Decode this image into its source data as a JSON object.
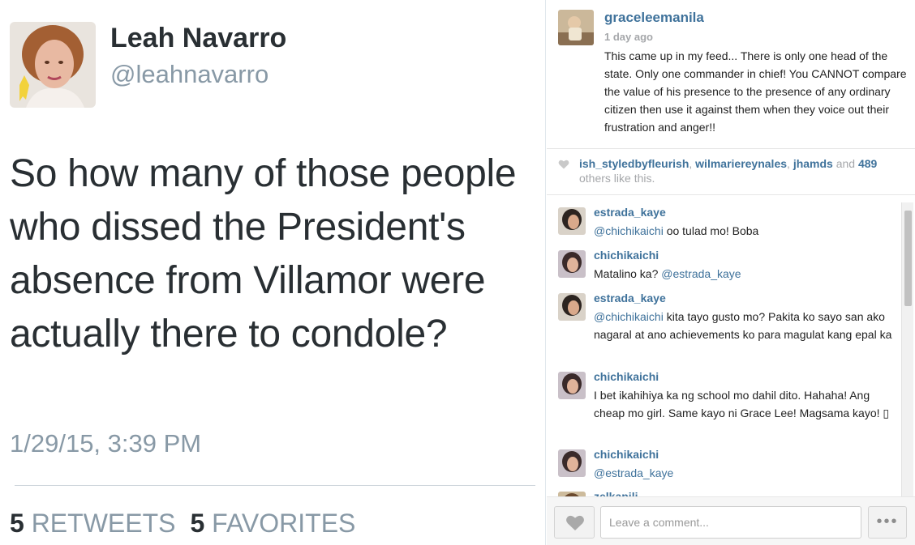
{
  "tweet": {
    "name": "Leah Navarro",
    "handle": "@leahnavarro",
    "text": "So how many of those people who dissed the President's absence from Villamor were actually there to condole?",
    "timestamp": "1/29/15, 3:39 PM",
    "retweets_count": "5",
    "retweets_label": "RETWEETS",
    "favorites_count": "5",
    "favorites_label": "FAVORITES"
  },
  "instagram": {
    "post": {
      "username": "graceleemanila",
      "time_ago": "1 day ago",
      "caption": "This came up in my feed... There is only one head of the state. Only one commander in chief! You CANNOT compare the value of his presence to the presence of any ordinary citizen then use it against them when they voice out their frustration and anger!!"
    },
    "likes": {
      "users": [
        "ish_styledbyfleurish",
        "wilmariereynales",
        "jhamds"
      ],
      "sep1": ", ",
      "sep2": ", ",
      "and_word": " and ",
      "count": "489",
      "suffix": " others like this."
    },
    "comments": [
      {
        "user": "estrada_kaye",
        "mention": "@chichikaichi",
        "text": " oo tulad mo! Boba"
      },
      {
        "user": "chichikaichi",
        "text": "Matalino ka? ",
        "mention_after": "@estrada_kaye"
      },
      {
        "user": "estrada_kaye",
        "mention": "@chichikaichi",
        "text": " kita tayo gusto mo? Pakita ko sayo san ako nagaral at ano achievements ko para magulat kang epal ka"
      },
      {
        "user": "chichikaichi",
        "text": "I bet ikahihiya ka ng school mo dahil dito. Hahaha! Ang cheap mo girl. Same kayo ni Grace Lee! Magsama kayo! ▯"
      },
      {
        "user": "chichikaichi",
        "mention": "@estrada_kaye",
        "text": ""
      },
      {
        "user": "zelkapili",
        "text": ""
      }
    ],
    "footer": {
      "comment_placeholder": "Leave a comment...",
      "more_label": "•••"
    }
  },
  "colors": {
    "twitter_text": "#292f33",
    "twitter_muted": "#8899a6",
    "instagram_link": "#3f729b",
    "instagram_muted": "#a5a7aa"
  },
  "icons": [
    "profile-photo",
    "yellow-ribbon-icon",
    "heart-icon",
    "ellipsis-icon"
  ]
}
